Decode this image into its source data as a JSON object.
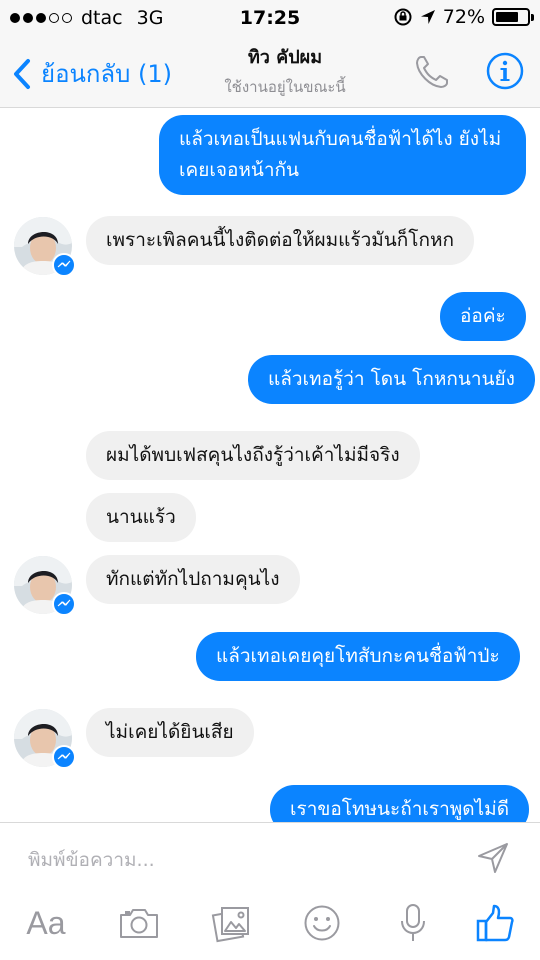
{
  "status": {
    "carrier": "dtac",
    "network": "3G",
    "time": "17:25",
    "battery": "72%",
    "battery_level": 0.72
  },
  "header": {
    "back_label": "ย้อนกลับ (1)",
    "contact_name": "ทิว คัปผม",
    "contact_status": "ใช้งานอยู่ในขณะนี้"
  },
  "messages": [
    {
      "dir": "out",
      "lines": [
        "แล้วเทอเป็นแฟนกับคนชื่อฟ้าได้ไง ยังไม่",
        "เคยเจอหน้ากัน"
      ]
    },
    {
      "dir": "in",
      "text": "เพราะเพิลคนนี้ไงติดต่อให้ผมแร้วมันก็โกหก"
    },
    {
      "dir": "out",
      "text": "อ่อค่ะ"
    },
    {
      "dir": "out",
      "text": "แล้วเทอรู้ว่า โดน โกหกนานยัง"
    },
    {
      "dir": "in",
      "text": "ผมได้พบเฟสคุนไงถึงรู้ว่าเค้าไม่มีจริง"
    },
    {
      "dir": "in",
      "text": "นานแร้ว"
    },
    {
      "dir": "in",
      "text": "ทักแต่ทักไปถามคุนไง"
    },
    {
      "dir": "out",
      "text": "แล้วเทอเคยคุยโทสับกะคนชื่อฟ้าป่ะ"
    },
    {
      "dir": "in",
      "text": "ไม่เคยได้ยินเสีย"
    },
    {
      "dir": "out",
      "text": "เราขอโทษนะถ้าเราพูดไม่ดี"
    }
  ],
  "composer": {
    "placeholder": "พิมพ์ข้อความ...",
    "text_format_label": "Aa"
  },
  "colors": {
    "accent": "#0b84ff",
    "incoming_bubble": "#f0f0f0",
    "bar_background": "#f7f7f7"
  },
  "icons": [
    "back-chevron-icon",
    "phone-icon",
    "info-icon",
    "messenger-badge-icon",
    "send-icon",
    "camera-icon",
    "gallery-icon",
    "emoji-icon",
    "microphone-icon",
    "like-icon"
  ]
}
